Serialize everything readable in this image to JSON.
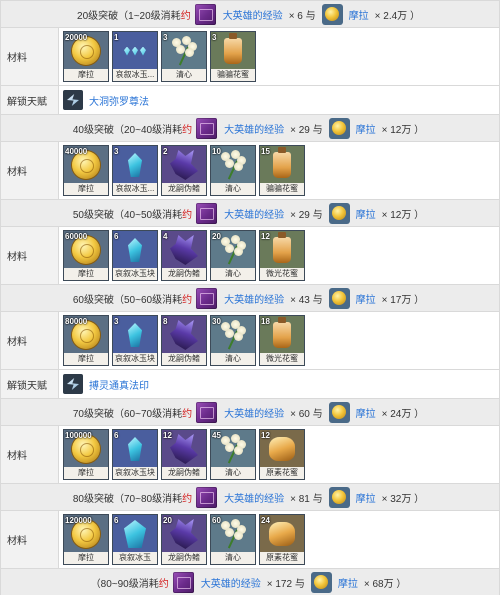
{
  "colors": {
    "accent_link": "#2a74d6",
    "highlight_red": "#d32020",
    "header_bg": "#ececec"
  },
  "labels": {
    "materials": "材料",
    "unlock_talent": "解锁天赋"
  },
  "common": {
    "exp_item": "大英雄的经验",
    "mora_item": "摩拉",
    "about_char": "约"
  },
  "sections": [
    {
      "header": {
        "prefix": "20级突破（1~20级消耗",
        "exp_count": "× 6 与",
        "mora_amount": "× 2.4万 ）"
      },
      "materials": [
        {
          "count": "20000",
          "name": "摩拉",
          "icon": "mora-coin-icon",
          "kind": "mora"
        },
        {
          "count": "1",
          "name": "哀叙冰玉...",
          "icon": "gem-fragment-icon",
          "kind": "gem-small"
        },
        {
          "count": "3",
          "name": "清心",
          "icon": "qingxin-flower-icon",
          "kind": "flower"
        },
        {
          "count": "3",
          "name": "骗骗花蜜",
          "icon": "nectar-bottle-icon",
          "kind": "bottle"
        }
      ],
      "talent": {
        "name": "大洞弥罗尊法",
        "icon": "talent-burst-icon"
      }
    },
    {
      "header": {
        "prefix": "40级突破（20~40级消耗",
        "exp_count": "× 29 与",
        "mora_amount": "× 12万 ）"
      },
      "materials": [
        {
          "count": "40000",
          "name": "摩拉",
          "icon": "mora-coin-icon",
          "kind": "mora"
        },
        {
          "count": "3",
          "name": "哀叙冰玉...",
          "icon": "gem-fragment-icon",
          "kind": "gem"
        },
        {
          "count": "2",
          "name": "龙嗣伪鳍",
          "icon": "dragon-fin-icon",
          "kind": "boss"
        },
        {
          "count": "10",
          "name": "清心",
          "icon": "qingxin-flower-icon",
          "kind": "flower"
        },
        {
          "count": "15",
          "name": "骗骗花蜜",
          "icon": "nectar-bottle-icon",
          "kind": "bottle"
        }
      ]
    },
    {
      "header": {
        "prefix": "50级突破（40~50级消耗",
        "exp_count": "× 29 与",
        "mora_amount": "× 12万 ）"
      },
      "materials": [
        {
          "count": "60000",
          "name": "摩拉",
          "icon": "mora-coin-icon",
          "kind": "mora"
        },
        {
          "count": "6",
          "name": "哀叙冰玉块",
          "icon": "gem-chunk-icon",
          "kind": "gem"
        },
        {
          "count": "4",
          "name": "龙嗣伪鳍",
          "icon": "dragon-fin-icon",
          "kind": "boss"
        },
        {
          "count": "20",
          "name": "清心",
          "icon": "qingxin-flower-icon",
          "kind": "flower"
        },
        {
          "count": "12",
          "name": "微光花蜜",
          "icon": "shimmering-nectar-icon",
          "kind": "bottle"
        }
      ]
    },
    {
      "header": {
        "prefix": "60级突破（50~60级消耗",
        "exp_count": "× 43 与",
        "mora_amount": "× 17万 ）"
      },
      "materials": [
        {
          "count": "80000",
          "name": "摩拉",
          "icon": "mora-coin-icon",
          "kind": "mora"
        },
        {
          "count": "3",
          "name": "哀叙冰玉块",
          "icon": "gem-chunk-icon",
          "kind": "gem"
        },
        {
          "count": "8",
          "name": "龙嗣伪鳍",
          "icon": "dragon-fin-icon",
          "kind": "boss"
        },
        {
          "count": "30",
          "name": "清心",
          "icon": "qingxin-flower-icon",
          "kind": "flower"
        },
        {
          "count": "18",
          "name": "微光花蜜",
          "icon": "shimmering-nectar-icon",
          "kind": "bottle"
        }
      ],
      "talent": {
        "name": "搏灵通真法印",
        "icon": "talent-seal-icon"
      }
    },
    {
      "header": {
        "prefix": "70级突破（60~70级消耗",
        "exp_count": "× 60 与",
        "mora_amount": "× 24万 ）"
      },
      "materials": [
        {
          "count": "100000",
          "name": "摩拉",
          "icon": "mora-coin-icon",
          "kind": "mora"
        },
        {
          "count": "6",
          "name": "哀叙冰玉块",
          "icon": "gem-chunk-icon",
          "kind": "gem"
        },
        {
          "count": "12",
          "name": "龙嗣伪鳍",
          "icon": "dragon-fin-icon",
          "kind": "boss"
        },
        {
          "count": "45",
          "name": "清心",
          "icon": "qingxin-flower-icon",
          "kind": "flower"
        },
        {
          "count": "12",
          "name": "原素花蜜",
          "icon": "energy-nectar-icon",
          "kind": "jar"
        }
      ]
    },
    {
      "header": {
        "prefix": "80级突破（70~80级消耗",
        "exp_count": "× 81 与",
        "mora_amount": "× 32万 ）"
      },
      "materials": [
        {
          "count": "120000",
          "name": "摩拉",
          "icon": "mora-coin-icon",
          "kind": "mora"
        },
        {
          "count": "6",
          "name": "哀叙冰玉",
          "icon": "gemstone-icon",
          "kind": "gem-big"
        },
        {
          "count": "20",
          "name": "龙嗣伪鳍",
          "icon": "dragon-fin-icon",
          "kind": "boss"
        },
        {
          "count": "60",
          "name": "清心",
          "icon": "qingxin-flower-icon",
          "kind": "flower"
        },
        {
          "count": "24",
          "name": "原素花蜜",
          "icon": "energy-nectar-icon",
          "kind": "jar"
        }
      ]
    }
  ],
  "footer": {
    "prefix": "（80~90级消耗",
    "exp_count": "× 172 与",
    "mora_amount": "× 68万 ）"
  }
}
